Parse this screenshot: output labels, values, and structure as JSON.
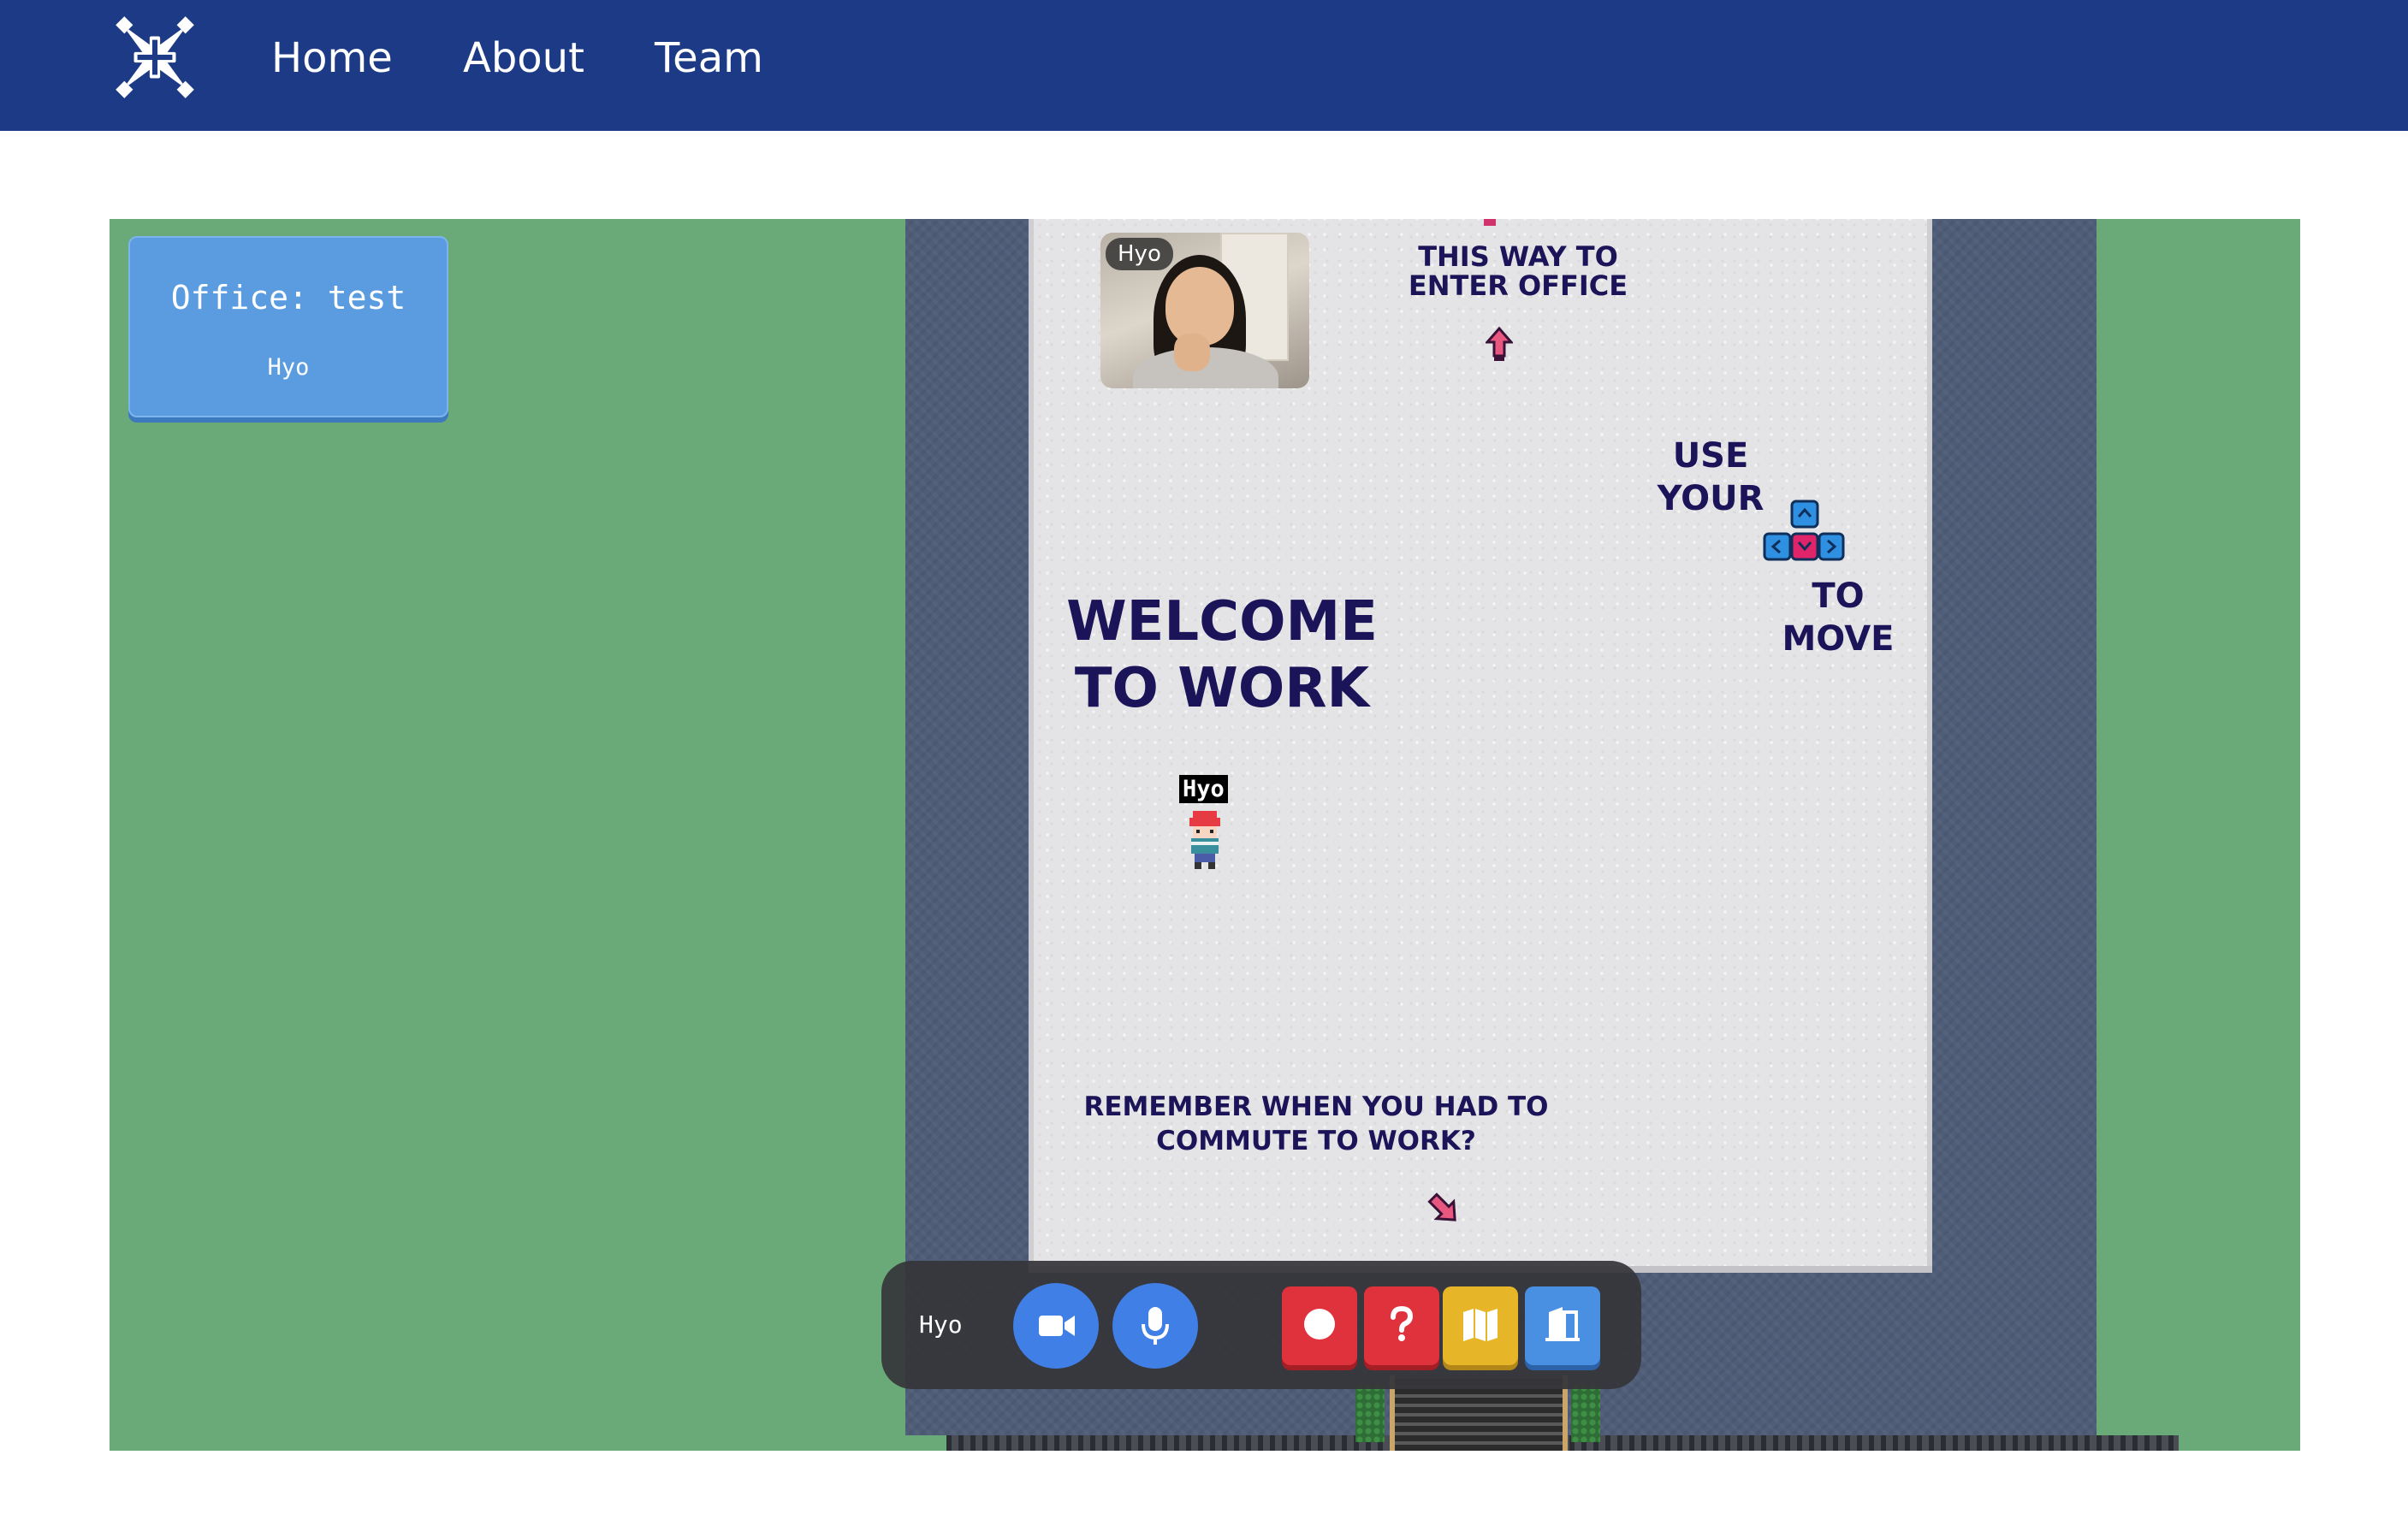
{
  "nav": {
    "logo_icon": "crossed-arrows-logo-icon",
    "links": [
      "Home",
      "About",
      "Team"
    ]
  },
  "office_panel": {
    "title": "Office: test",
    "user": "Hyo"
  },
  "video_tile": {
    "name": "Hyo"
  },
  "signs": {
    "enter_office_line1": "THIS WAY TO",
    "enter_office_line2": "ENTER OFFICE",
    "welcome_line1": "WELCOME",
    "welcome_line2": "TO WORK",
    "use_line1": "USE",
    "use_line2": "YOUR",
    "move_line1": "TO",
    "move_line2": "MOVE",
    "remember_line1": "REMEMBER WHEN YOU HAD TO",
    "remember_line2": "COMMUTE TO WORK?"
  },
  "player": {
    "name": "Hyo"
  },
  "control_bar": {
    "user_name": "Hyo",
    "buttons": [
      {
        "icon": "video-camera-icon",
        "color": "#3f7fe6"
      },
      {
        "icon": "microphone-icon",
        "color": "#3f7fe6"
      },
      {
        "icon": "record-icon",
        "color": "#e0323c"
      },
      {
        "icon": "help-icon",
        "color": "#e0323c"
      },
      {
        "icon": "map-icon",
        "color": "#e6b528"
      },
      {
        "icon": "exit-door-icon",
        "color": "#4a90e2"
      }
    ]
  },
  "colors": {
    "navbar": "#1c3a85",
    "grass": "#6aaa79",
    "wall": "#4f5d78",
    "floor": "#e4e4e6",
    "sign_text": "#1c1458",
    "panel": "#5b9ce0"
  }
}
